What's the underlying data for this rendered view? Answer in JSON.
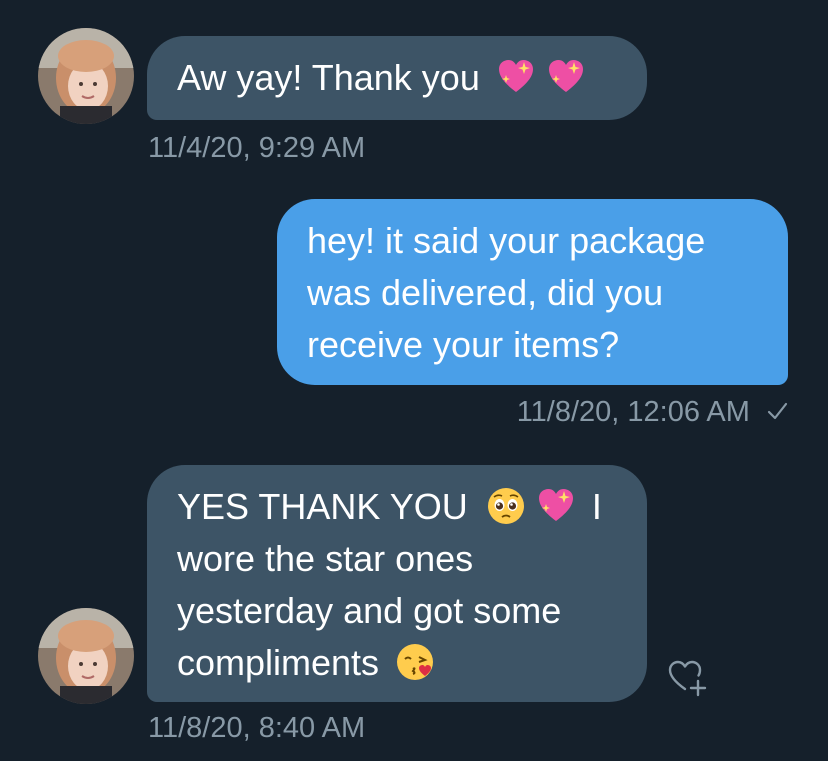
{
  "conversation": {
    "messages": [
      {
        "direction": "received",
        "lines": [
          "Aw yay! Thank you"
        ],
        "emoji": [
          "sparkling-heart",
          "sparkling-heart"
        ],
        "timestamp": "11/4/20, 9:29 AM"
      },
      {
        "direction": "sent",
        "lines": [
          "hey! it said your package",
          "was delivered, did you",
          "receive your items?"
        ],
        "timestamp": "11/8/20, 12:06 AM",
        "status": "sent-check"
      },
      {
        "direction": "received",
        "lines": [
          "YES THANK YOU",
          "I",
          "wore the star ones",
          "yesterday and got some",
          "compliments"
        ],
        "emoji_line1": [
          "pleading-face",
          "sparkling-heart"
        ],
        "emoji_line4": [
          "face-blowing-kiss"
        ],
        "timestamp": "11/8/20, 8:40 AM"
      }
    ]
  },
  "colors": {
    "background": "#15202b",
    "received_bubble": "#3d5466",
    "sent_bubble": "#4a9fe8",
    "timestamp_text": "#8899a6",
    "message_text": "#ffffff"
  },
  "icons": {
    "avatar": "user-avatar",
    "reaction": "heart-plus-icon",
    "read_status": "check-icon"
  }
}
